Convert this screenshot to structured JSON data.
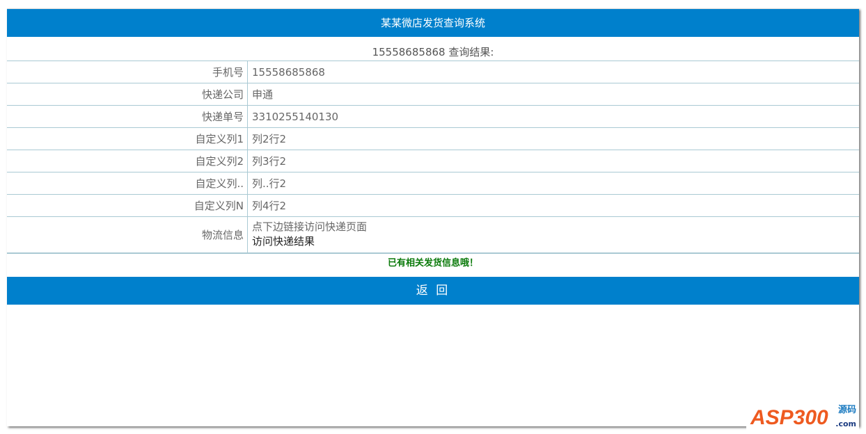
{
  "header": {
    "title": "某某微店发货查询系统"
  },
  "result_title": "15558685868 查询结果:",
  "rows": [
    {
      "label": "手机号",
      "value": "15558685868"
    },
    {
      "label": "快递公司",
      "value": "申通"
    },
    {
      "label": "快递单号",
      "value": "3310255140130"
    },
    {
      "label": "自定义列1",
      "value": "列2行2"
    },
    {
      "label": "自定义列2",
      "value": "列3行2"
    },
    {
      "label": "自定义列..",
      "value": "列..行2"
    },
    {
      "label": "自定义列N",
      "value": "列4行2"
    }
  ],
  "logistics": {
    "label": "物流信息",
    "hint": "点下边链接访问快递页面",
    "link": "访问快递结果"
  },
  "message": "已有相关发货信息哦！",
  "back_label": "返 回",
  "watermark": {
    "brand": "ASP300",
    "cn": "源码",
    "domain": ".com"
  }
}
